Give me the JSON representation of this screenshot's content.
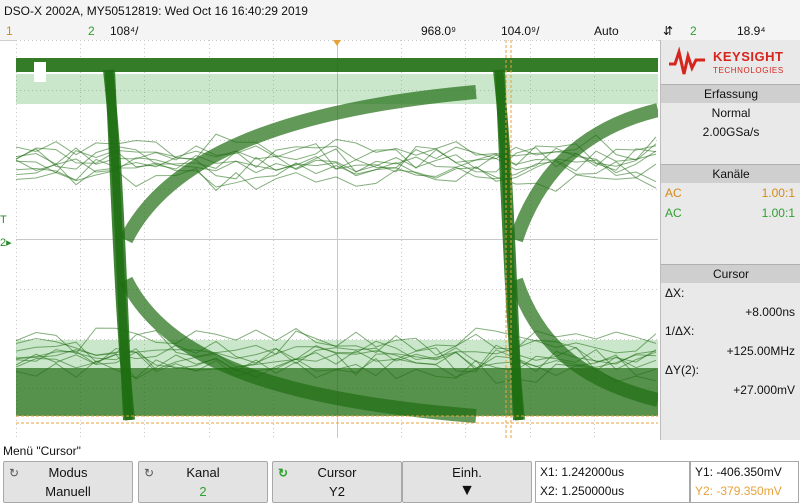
{
  "title_bar": {
    "text": "DSO-X 2002A, MY50512819: Wed Oct 16 16:40:29 2019"
  },
  "status_bar": {
    "ch1_num": "1",
    "ch2_num": "2",
    "ch2_scale": "108⁴/",
    "time_position": "968.0⁹",
    "time_scale": "104.0⁹/",
    "trigger_mode": "Auto",
    "trigger_symbol": "⇵",
    "trigger_channel": "2",
    "trigger_level": "18.9⁴"
  },
  "side_panel": {
    "brand": "KEYSIGHT",
    "brand_sub": "TECHNOLOGIES",
    "acquisition": {
      "header": "Erfassung",
      "mode": "Normal",
      "rate": "2.00GSa/s"
    },
    "channels": {
      "header": "Kanäle",
      "rows": [
        {
          "coupling": "AC",
          "probe": "1.00:1"
        },
        {
          "coupling": "AC",
          "probe": "1.00:1"
        }
      ]
    },
    "cursor": {
      "header": "Cursor",
      "dx_label": "ΔX:",
      "dx_value": "+8.000ns",
      "inv_label": "1/ΔX:",
      "inv_value": "+125.00MHz",
      "dy_label": "ΔY(2):",
      "dy_value": "+27.000mV"
    }
  },
  "menu": {
    "label": "Menü \"Cursor\""
  },
  "softkeys": [
    {
      "line1": "Modus",
      "line2": "Manuell"
    },
    {
      "line1": "Kanal",
      "line2": "2"
    },
    {
      "line1": "Cursor",
      "line2": "Y2"
    },
    {
      "line1": "Einh.",
      "line2": "▼"
    }
  ],
  "readouts": {
    "x1": "X1: 1.242000us",
    "x2": "X2: 1.250000us",
    "y1": "Y1: -406.350mV",
    "y2": "Y2: -379.350mV"
  },
  "markers": {
    "ch2_ground": "2▸",
    "trigger_level": "T"
  },
  "colors": {
    "ch1": "#d48a16",
    "ch2": "#2fa12f",
    "trace": "#1f6e12",
    "cursor": "#e8a23a",
    "brand": "#d6251d"
  }
}
